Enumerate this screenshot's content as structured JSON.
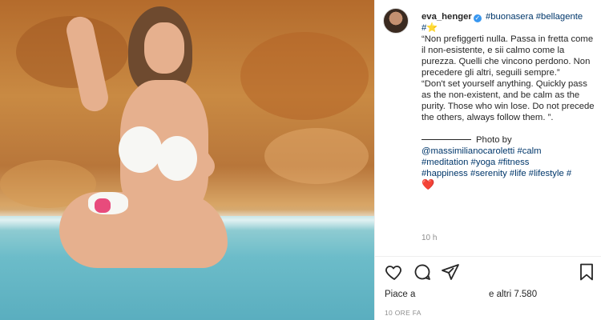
{
  "post": {
    "image_alt": "Photo of a woman in a white bikini sitting in turquoise water in front of an orange rock wall",
    "author": {
      "username": "eva_henger",
      "verified": true,
      "avatar_icon": "profile-avatar"
    },
    "caption": {
      "tag1": "#buonasera",
      "tag2": "#bellagente",
      "tag3": "#",
      "star": "⭐",
      "quote_it": "“Non prefiggerti nulla. Passa in fretta come il non-esistente, e sii calmo come la purezza. Quelli che vincono perdono. Non precedere gli altri, seguili sempre.”",
      "quote_en": "“Don't set yourself anything. Quickly pass as the non-existent, and be calm as the purity. Those who win lose. Do not precede the others, always follow them. ”.",
      "photo_by": "Photo by",
      "photographer": "@massimilianocaroletti",
      "tags_line1": [
        "#calm"
      ],
      "tags_line2": [
        "#meditation",
        "#yoga",
        "#fitness"
      ],
      "tags_line3": [
        "#happiness",
        "#serenity",
        "#life",
        "#lifestyle",
        "#"
      ],
      "heart": "❤️"
    },
    "comment_time": "10 h",
    "likes_prefix": "Piace a",
    "likes_suffix": "e altri 7.580",
    "timestamp": "10 ORE FA"
  },
  "colors": {
    "link": "#00376b",
    "text": "#262626",
    "muted": "#8e8e8e",
    "verified": "#3897f0",
    "heart": "#d6263a"
  },
  "icons": [
    "like-heart-icon",
    "comment-icon",
    "share-icon",
    "bookmark-icon",
    "verified-badge-icon",
    "star-icon"
  ]
}
